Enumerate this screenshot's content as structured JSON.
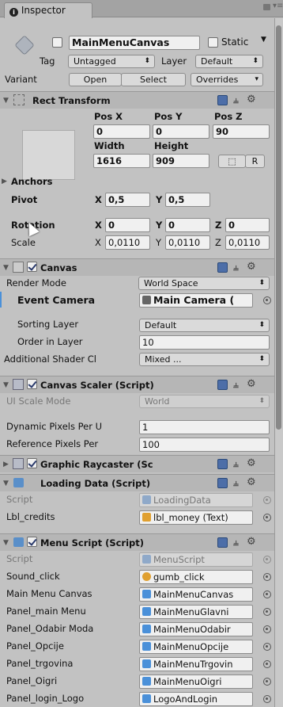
{
  "tab": {
    "icon": "info-icon",
    "label": "Inspector"
  },
  "object": {
    "name": "MainMenuCanvas",
    "static_label": "Static",
    "tag_label": "Tag",
    "tag_value": "Untagged",
    "layer_label": "Layer",
    "layer_value": "Default",
    "variant_label": "Variant",
    "open_label": "Open",
    "select_label": "Select",
    "overrides_label": "Overrides"
  },
  "rect": {
    "title": "Rect Transform",
    "posx_label": "Pos X",
    "posy_label": "Pos Y",
    "posz_label": "Pos Z",
    "posx": "0",
    "posy": "0",
    "posz": "90",
    "width_label": "Width",
    "height_label": "Height",
    "width": "1616",
    "height": "909",
    "r_label": "R",
    "anchors_label": "Anchors",
    "pivot_label": "Pivot",
    "pivot_x": "0,5",
    "pivot_y": "0,5",
    "rotation_label": "Rotation",
    "rot_x": "0",
    "rot_y": "0",
    "rot_z": "0",
    "scale_label": "Scale",
    "scale_x": "0,0110",
    "scale_y": "0,0110",
    "scale_z": "0,0110",
    "x": "X",
    "y": "Y",
    "z": "Z"
  },
  "canvas": {
    "title": "Canvas",
    "render_mode_label": "Render Mode",
    "render_mode": "World Space",
    "event_camera_label": "Event Camera",
    "event_camera": "Main Camera (",
    "sorting_layer_label": "Sorting Layer",
    "sorting_layer": "Default",
    "order_label": "Order in Layer",
    "order": "10",
    "shader_label": "Additional Shader Cl",
    "shader": "Mixed ..."
  },
  "scaler": {
    "title": "Canvas Scaler (Script)",
    "ui_scale_label": "UI Scale Mode",
    "ui_scale": "World",
    "dynamic_label": "Dynamic Pixels Per U",
    "dynamic": "1",
    "reference_label": "Reference Pixels Per",
    "reference": "100"
  },
  "raycaster": {
    "title": "Graphic Raycaster (Sc"
  },
  "loading": {
    "title": "Loading Data (Script)",
    "script_label": "Script",
    "script": "LoadingData",
    "credits_label": "Lbl_credits",
    "credits": "lbl_money (Text)"
  },
  "menu": {
    "title": "Menu Script (Script)",
    "rows": [
      {
        "label": "Script",
        "value": "MenuScript"
      },
      {
        "label": "Sound_click",
        "value": "gumb_click"
      },
      {
        "label": "Main Menu Canvas",
        "value": "MainMenuCanvas"
      },
      {
        "label": "Panel_main Menu",
        "value": "MainMenuGlavni"
      },
      {
        "label": "Panel_Odabir Moda",
        "value": "MainMenuOdabir"
      },
      {
        "label": "Panel_Opcije",
        "value": "MainMenuOpcije"
      },
      {
        "label": "Panel_trgovina",
        "value": "MainMenuTrgovin"
      },
      {
        "label": "Panel_Oigri",
        "value": "MainMenuOigri"
      },
      {
        "label": "Panel_login_Logo",
        "value": "LogoAndLogin"
      }
    ]
  }
}
